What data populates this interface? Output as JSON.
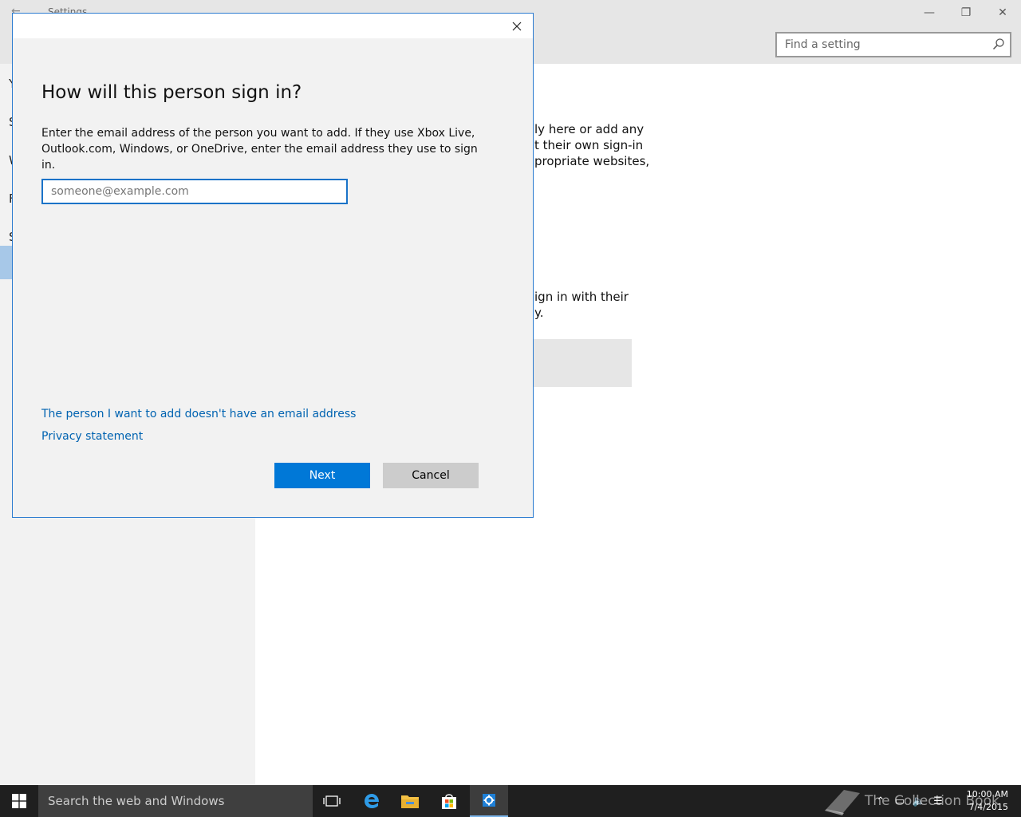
{
  "settings": {
    "window_title": "Settings",
    "search_placeholder": "Find a setting",
    "left_items": [
      "Y",
      "S",
      "W",
      "F",
      "S"
    ],
    "bg_lines_1": [
      "ly here or add any",
      "t their own sign-in",
      "propriate websites,"
    ],
    "bg_lines_2": [
      "ign in with their",
      "y."
    ]
  },
  "dialog": {
    "heading": "How will this person sign in?",
    "description": "Enter the email address of the person you want to add. If they use Xbox Live, Outlook.com, Windows, or OneDrive, enter the email address they use to sign in.",
    "email_placeholder": "someone@example.com",
    "email_value": "",
    "no_email_link": "The person I want to add doesn't have an email address",
    "privacy_link": "Privacy statement",
    "next_label": "Next",
    "cancel_label": "Cancel"
  },
  "taskbar": {
    "search_placeholder": "Search the web and Windows",
    "time": "10:00 AM",
    "date": "7/4/2015",
    "watermark": "The Collection Book"
  },
  "colors": {
    "accent": "#0078d7",
    "link": "#0063b1",
    "taskbar": "#1f1f1f"
  }
}
